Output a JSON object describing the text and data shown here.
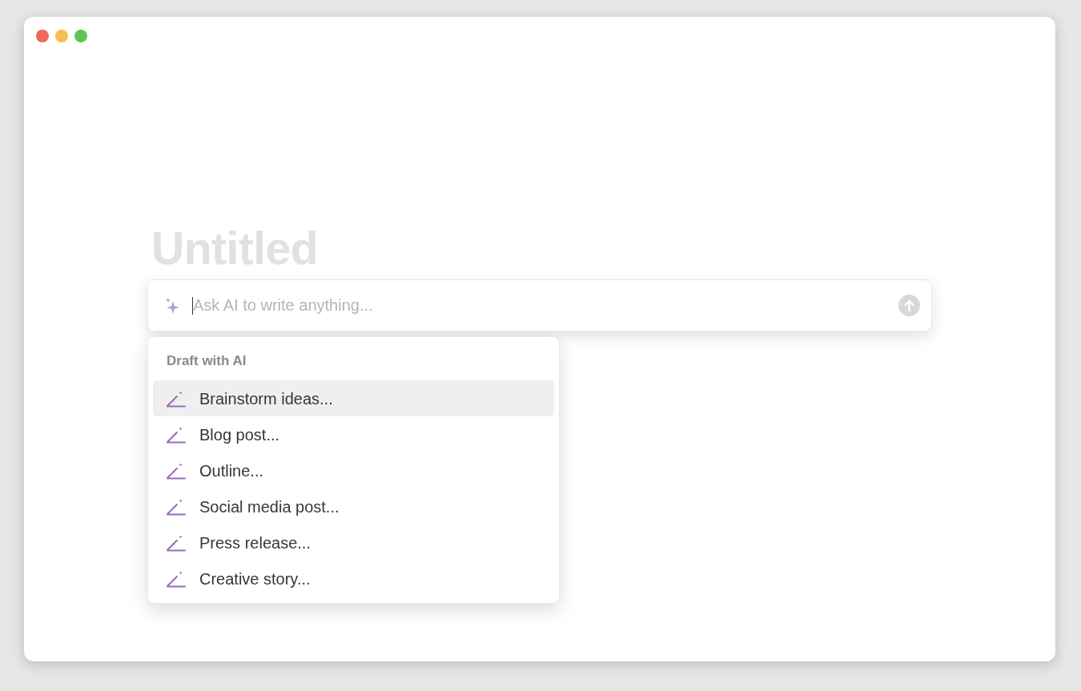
{
  "page": {
    "title": "Untitled"
  },
  "ai_prompt": {
    "placeholder": "Ask AI to write anything..."
  },
  "menu": {
    "heading": "Draft with AI",
    "items": [
      {
        "label": "Brainstorm ideas...",
        "selected": true
      },
      {
        "label": "Blog post...",
        "selected": false
      },
      {
        "label": "Outline...",
        "selected": false
      },
      {
        "label": "Social media post...",
        "selected": false
      },
      {
        "label": "Press release...",
        "selected": false
      },
      {
        "label": "Creative story...",
        "selected": false
      }
    ]
  }
}
